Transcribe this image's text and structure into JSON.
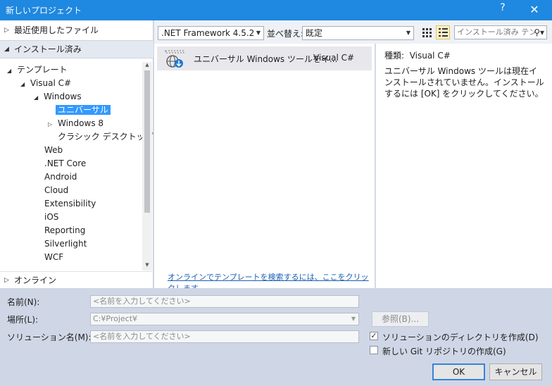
{
  "window": {
    "title": "新しいプロジェクト",
    "help": "?",
    "close": "✕"
  },
  "left": {
    "recent_label": "最近使用したファイル",
    "installed_label": "インストール済み",
    "online_label": "オンライン",
    "tree": {
      "templates": "テンプレート",
      "visual_csharp": "Visual C#",
      "windows": "Windows",
      "universal": "ユニバーサル",
      "windows8": "Windows 8",
      "classic_desktop": "クラシック デスクトップ",
      "items": [
        "Web",
        ".NET Core",
        "Android",
        "Cloud",
        "Extensibility",
        "iOS",
        "Reporting",
        "Silverlight",
        "WCF"
      ]
    }
  },
  "toolbar": {
    "framework": ".NET Framework 4.5.2",
    "sort_label": "並べ替え:",
    "sort_value": "既定",
    "search_placeholder": "インストール済み テン"
  },
  "center": {
    "template_name": "ユニバーサル Windows ツールをイ...",
    "template_lang": "Visual C#",
    "online_link": "オンラインでテンプレートを検索するには、ここをクリックします。"
  },
  "right": {
    "kind_label": "種類:",
    "kind_value": "Visual C#",
    "description": "ユニバーサル Windows ツールは現在インストールされていません。インストールするには [OK] をクリックしてください。"
  },
  "form": {
    "name_label": "名前(N):",
    "name_placeholder": "<名前を入力してください>",
    "location_label": "場所(L):",
    "location_value": "C:¥Project¥",
    "solution_label": "ソリューション名(M):",
    "solution_placeholder": "<名前を入力してください>",
    "browse_label": "参照(B)...",
    "create_dir_label": "ソリューションのディレクトリを作成(D)",
    "create_dir_checked": true,
    "git_label": "新しい Git リポジトリの作成(G)",
    "git_checked": false,
    "ok_label": "OK",
    "cancel_label": "キャンセル"
  },
  "colors": {
    "titlebar": "#1f88e0",
    "selection": "#3399ff",
    "link": "#1a5fb4",
    "dialog_bg": "#cfd7e6"
  }
}
